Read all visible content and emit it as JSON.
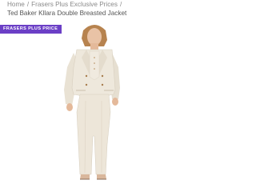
{
  "breadcrumb": {
    "items": [
      "Home",
      "Frasers Plus Exclusive Prices"
    ],
    "separator": "/",
    "current": "Ted Baker Kllara Double Breasted Jacket"
  },
  "badge": {
    "label": "FRASERS PLUS PRICE",
    "color": "#6b3fc6"
  },
  "product_image": {
    "alt": "Model wearing cream double breasted suit jacket and trousers"
  }
}
